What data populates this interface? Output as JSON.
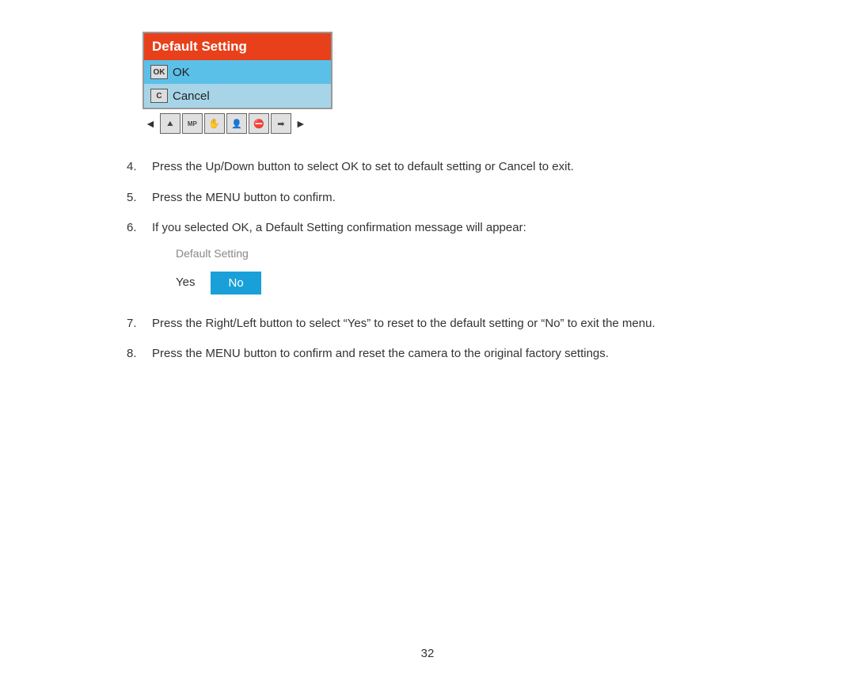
{
  "page": {
    "number": "32"
  },
  "camera_menu": {
    "title": "Default Setting",
    "items": [
      {
        "id": "ok",
        "icon_text": "OK",
        "label": "OK",
        "selected": true
      },
      {
        "id": "cancel",
        "icon_text": "C",
        "label": "Cancel",
        "selected": false
      }
    ]
  },
  "confirmation_dialog": {
    "title": "Default Setting",
    "yes_label": "Yes",
    "no_label": "No"
  },
  "steps": [
    {
      "num": "4.",
      "text": "Press the Up/Down button to select OK to set to default setting or Cancel to exit."
    },
    {
      "num": "5.",
      "text": "Press the MENU button to confirm."
    },
    {
      "num": "6.",
      "text": "If you selected OK, a Default Setting confirmation message will appear:"
    },
    {
      "num": "7.",
      "text": "Press the Right/Left button to select “Yes” to reset to the default setting or “No” to exit the menu."
    },
    {
      "num": "8.",
      "text": "Press the MENU button to confirm and reset the camera to the original factory settings."
    }
  ],
  "icon_bar": {
    "left_arrow": "◄",
    "right_arrow": "►",
    "icons": [
      "🌅",
      "MP",
      "✋",
      "👤",
      "⛔",
      "➡"
    ]
  }
}
